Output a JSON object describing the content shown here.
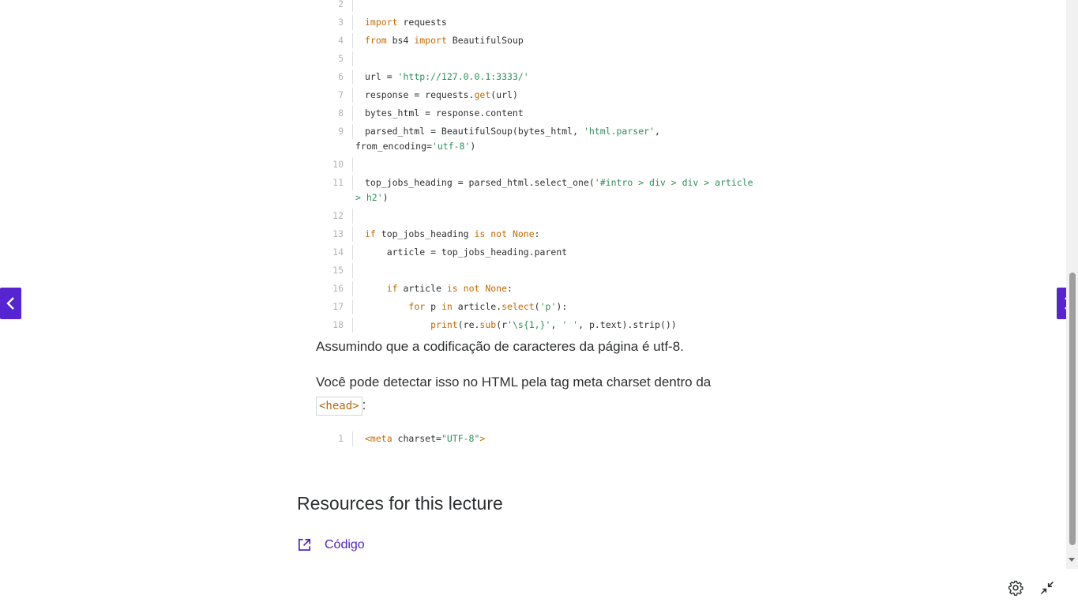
{
  "code_block_1": {
    "lines": [
      {
        "n": "2",
        "text": ""
      },
      {
        "n": "3",
        "tokens": [
          [
            "kw",
            "import"
          ],
          [
            "t",
            " requests"
          ]
        ]
      },
      {
        "n": "4",
        "tokens": [
          [
            "kw",
            "from"
          ],
          [
            "t",
            " bs4 "
          ],
          [
            "kw",
            "import"
          ],
          [
            "t",
            " BeautifulSoup"
          ]
        ]
      },
      {
        "n": "5",
        "text": ""
      },
      {
        "n": "6",
        "tokens": [
          [
            "t",
            "url = "
          ],
          [
            "str",
            "'http://127.0.0.1:3333/'"
          ]
        ]
      },
      {
        "n": "7",
        "tokens": [
          [
            "t",
            "response = requests."
          ],
          [
            "fn",
            "get"
          ],
          [
            "t",
            "(url)"
          ]
        ]
      },
      {
        "n": "8",
        "tokens": [
          [
            "t",
            "bytes_html = response.content"
          ]
        ]
      },
      {
        "n": "9",
        "tokens": [
          [
            "t",
            "parsed_html = BeautifulSoup(bytes_html, "
          ],
          [
            "str",
            "'html.parser'"
          ],
          [
            "t",
            ","
          ]
        ],
        "wrap": [
          [
            "t",
            "from_encoding="
          ],
          [
            "str",
            "'utf-8'"
          ],
          [
            "t",
            ")"
          ]
        ]
      },
      {
        "n": "10",
        "text": ""
      },
      {
        "n": "11",
        "tokens": [
          [
            "t",
            "top_jobs_heading = parsed_html.select_one("
          ],
          [
            "str",
            "'#intro > div > div > article"
          ]
        ],
        "wrap": [
          [
            "str",
            "> h2'"
          ],
          [
            "t",
            ")"
          ]
        ]
      },
      {
        "n": "12",
        "text": ""
      },
      {
        "n": "13",
        "tokens": [
          [
            "kw",
            "if"
          ],
          [
            "t",
            " top_jobs_heading "
          ],
          [
            "kw",
            "is not None"
          ],
          [
            "t",
            ":"
          ]
        ]
      },
      {
        "n": "14",
        "tokens": [
          [
            "t",
            "    article = top_jobs_heading.parent"
          ]
        ]
      },
      {
        "n": "15",
        "text": ""
      },
      {
        "n": "16",
        "tokens": [
          [
            "t",
            "    "
          ],
          [
            "kw",
            "if"
          ],
          [
            "t",
            " article "
          ],
          [
            "kw",
            "is not None"
          ],
          [
            "t",
            ":"
          ]
        ]
      },
      {
        "n": "17",
        "tokens": [
          [
            "t",
            "        "
          ],
          [
            "kw",
            "for"
          ],
          [
            "t",
            " p "
          ],
          [
            "kw",
            "in"
          ],
          [
            "t",
            " article."
          ],
          [
            "fn",
            "select"
          ],
          [
            "t",
            "("
          ],
          [
            "str",
            "'p'"
          ],
          [
            "t",
            "):"
          ]
        ]
      },
      {
        "n": "18",
        "tokens": [
          [
            "t",
            "            "
          ],
          [
            "fn",
            "print"
          ],
          [
            "t",
            "(re."
          ],
          [
            "fn",
            "sub"
          ],
          [
            "t",
            "(r"
          ],
          [
            "str",
            "'\\s{1,}'"
          ],
          [
            "t",
            ", "
          ],
          [
            "str",
            "' '"
          ],
          [
            "t",
            ", p.text).strip())"
          ]
        ]
      }
    ]
  },
  "prose": {
    "paragraph_1": "Assumindo que a codificação de caracteres da página é utf-8.",
    "paragraph_2_text": "Você pode detectar isso no HTML pela tag meta charset dentro da",
    "paragraph_2_code": "<head>",
    "paragraph_2_tail": ":"
  },
  "code_block_2": {
    "lines": [
      {
        "n": "1",
        "tokens": [
          [
            "kw",
            "<meta"
          ],
          [
            "t",
            " charset="
          ],
          [
            "str",
            "\"UTF-8\""
          ],
          [
            "kw",
            ">"
          ]
        ]
      }
    ]
  },
  "resources": {
    "title": "Resources for this lecture",
    "link_label": "Código",
    "link_icon": "external-link-icon"
  },
  "navigation": {
    "prev_icon": "chevron-left-icon",
    "next_icon": "chevron-right-icon"
  },
  "bottom_controls": {
    "settings_icon": "gear-icon",
    "exit_fullscreen_icon": "exit-fullscreen-icon"
  },
  "colors": {
    "accent": "#5624d0",
    "link": "#5022c3",
    "keyword": "#c26a00",
    "string": "#2f8f5b"
  }
}
